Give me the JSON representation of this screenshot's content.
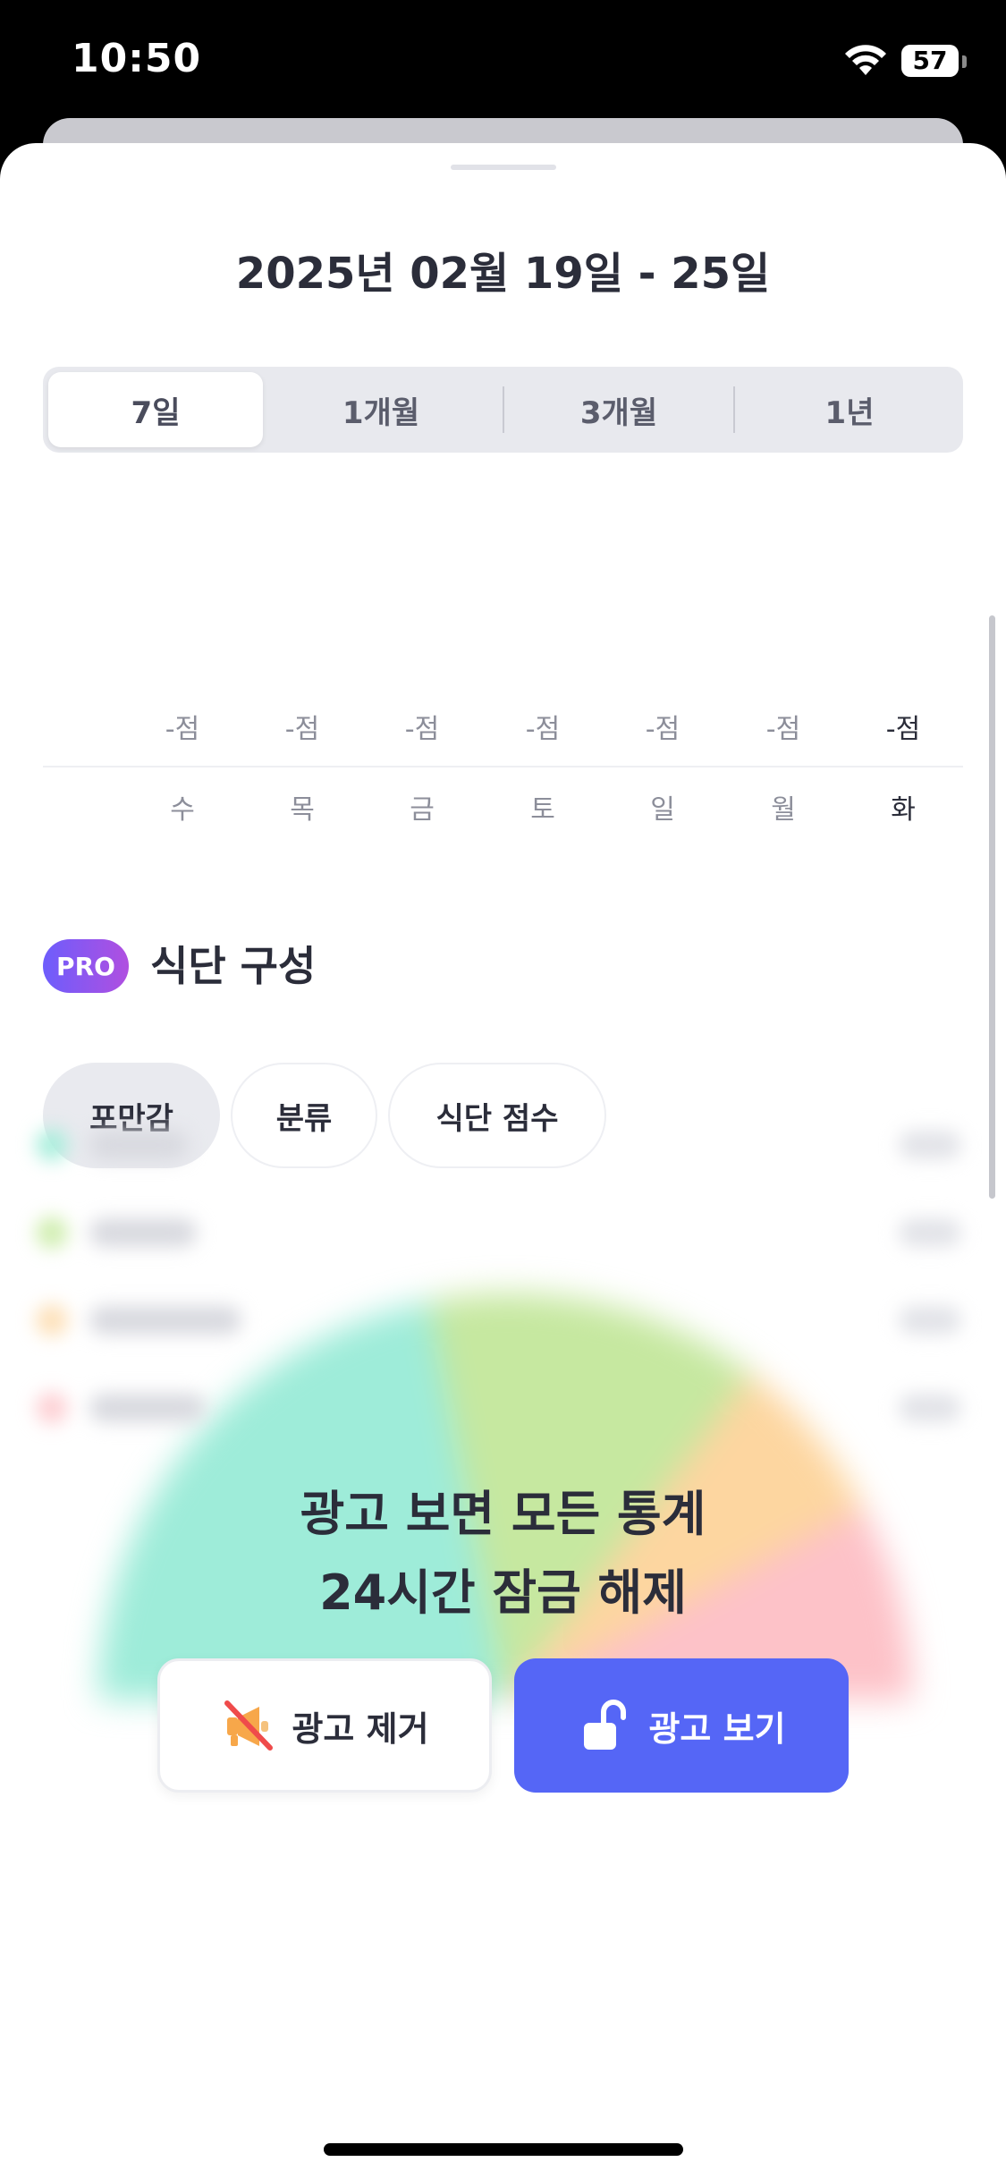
{
  "status_bar": {
    "time": "10:50",
    "battery": "57"
  },
  "header": {
    "date_range": "2025년 02월 19일 - 25일"
  },
  "period_tabs": [
    {
      "label": "7일",
      "active": true
    },
    {
      "label": "1개월",
      "active": false
    },
    {
      "label": "3개월",
      "active": false
    },
    {
      "label": "1년",
      "active": false
    }
  ],
  "score_chart": {
    "scores": [
      "-점",
      "-점",
      "-점",
      "-점",
      "-점",
      "-점",
      "-점"
    ],
    "days": [
      "수",
      "목",
      "금",
      "토",
      "일",
      "월",
      "화"
    ]
  },
  "section": {
    "badge": "PRO",
    "title": "식단 구성"
  },
  "filter_chips": [
    {
      "label": "포만감",
      "active": true
    },
    {
      "label": "분류",
      "active": false
    },
    {
      "label": "식단 점수",
      "active": false
    }
  ],
  "pie_colors": [
    "#9eecd9",
    "#c6e8a0",
    "#fdd6a0",
    "#fdc2c8"
  ],
  "unlock": {
    "line1": "광고 보면 모든 통계",
    "line2": "24시간 잠금 해제",
    "remove_ads_label": "광고 제거",
    "watch_ad_label": "광고 보기"
  },
  "icons": {
    "wifi": "wifi-icon",
    "battery": "battery-icon",
    "remove_ads": "megaphone-slash-icon",
    "watch_ad": "unlock-icon"
  }
}
